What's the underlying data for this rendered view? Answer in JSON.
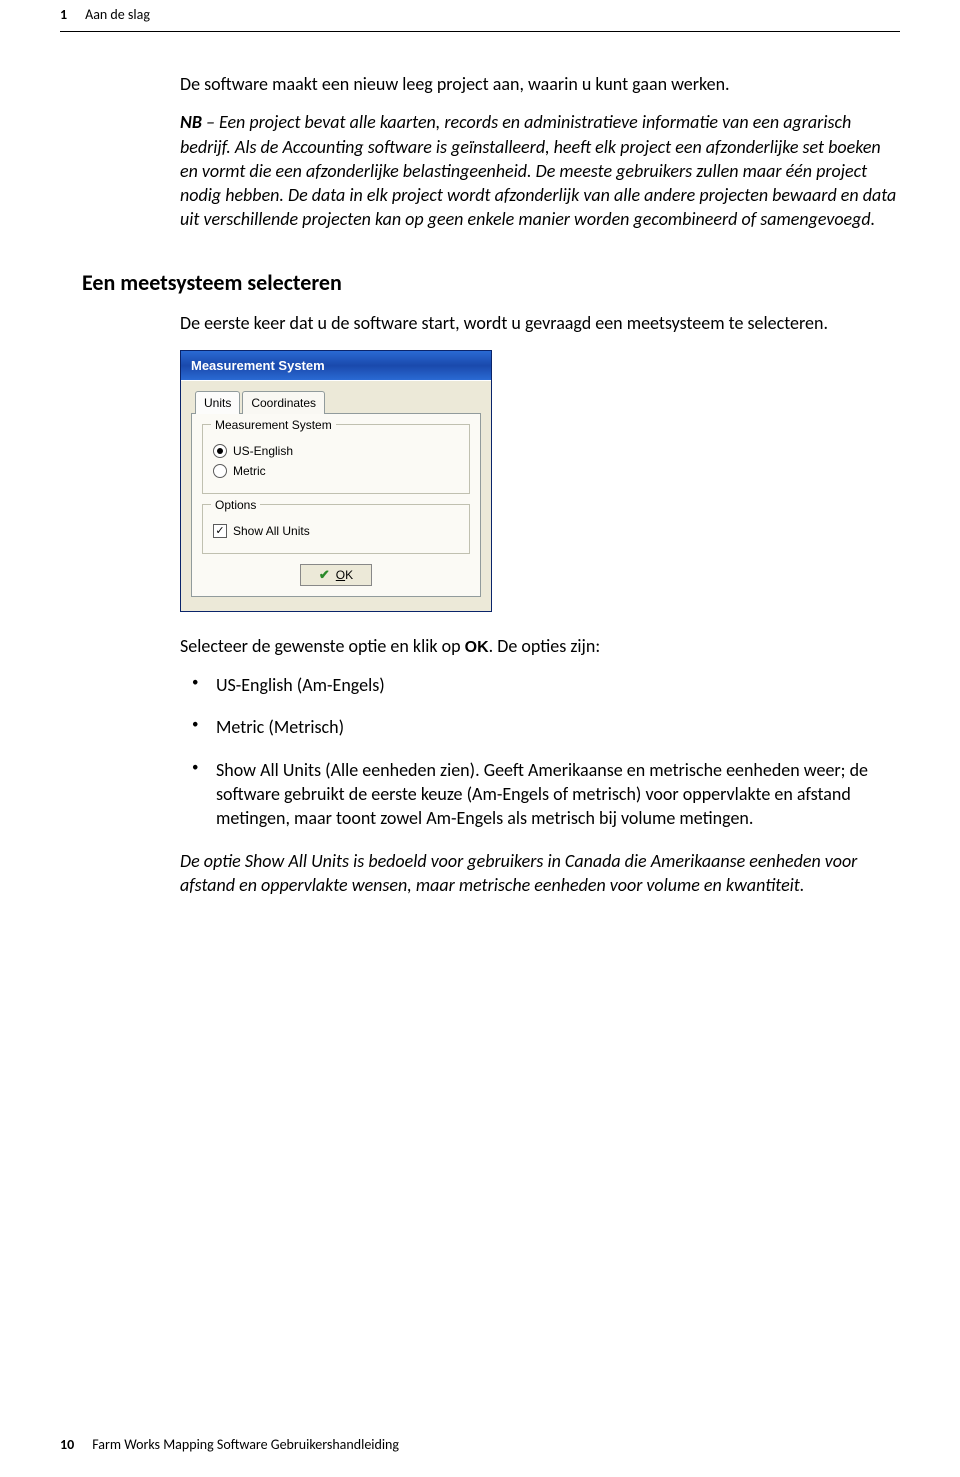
{
  "header": {
    "chapter_num": "1",
    "chapter_title": "Aan de slag"
  },
  "body": {
    "p1": "De software maakt een nieuw leeg project aan, waarin u kunt gaan werken.",
    "p2a": "NB",
    "p2b": " – Een project bevat alle kaarten, records en administratieve informatie van een agrarisch bedrijf. Als de Accounting software is geïnstalleerd, heeft elk project een afzonderlijke set boeken en vormt die een afzonderlijke belastingeenheid. De meeste gebruikers zullen maar één project nodig hebben. De data in elk project wordt afzonderlijk van alle andere projecten bewaard en data uit verschillende projecten kan op geen enkele manier worden gecombineerd of samengevoegd.",
    "h2": "Een meetsysteem selecteren",
    "p3": "De eerste keer dat u de software start, wordt u gevraagd een meetsysteem te selecteren.",
    "p4a": "Selecteer de gewenste optie en klik op ",
    "p4_ok": "OK",
    "p4b": ". De opties zijn:",
    "opt1": "US-English (Am-Engels)",
    "opt2": "Metric (Metrisch)",
    "opt3": "Show All Units (Alle eenheden zien). Geeft Amerikaanse en metrische eenheden weer; de software gebruikt de eerste keuze (Am-Engels of metrisch) voor oppervlakte en afstand metingen, maar toont zowel Am-Engels als metrisch bij volume metingen.",
    "p5": "De optie Show All Units is bedoeld voor gebruikers in Canada die Amerikaanse eenheden voor afstand en oppervlakte wensen, maar metrische eenheden voor volume en kwantiteit."
  },
  "dialog": {
    "title": "Measurement System",
    "tab1": "Units",
    "tab2": "Coordinates",
    "group1": "Measurement System",
    "radio1": "US-English",
    "radio2": "Metric",
    "group2": "Options",
    "check1": "Show All Units",
    "ok_under": "O",
    "ok_rest": "K"
  },
  "footer": {
    "page": "10",
    "title": "Farm Works Mapping Software Gebruikershandleiding"
  }
}
